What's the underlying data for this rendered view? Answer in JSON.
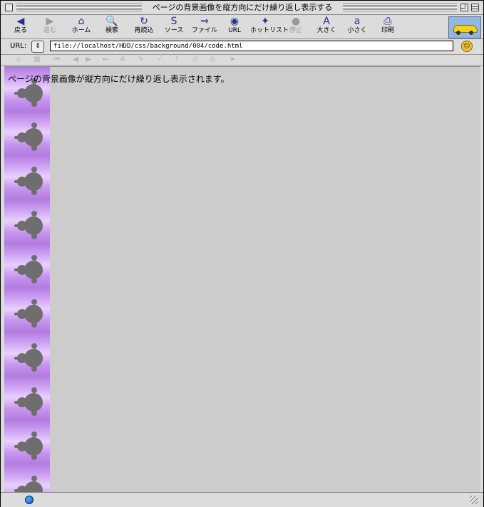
{
  "window": {
    "title": "ページの背景画像を縦方向にだけ繰り返し表示する"
  },
  "toolbar": {
    "buttons": [
      {
        "label": "戻る",
        "icon": "back-arrow-icon",
        "glyph": "◀",
        "enabled": true
      },
      {
        "label": "進む",
        "icon": "forward-arrow-icon",
        "glyph": "▶",
        "enabled": false
      },
      {
        "label": "ホーム",
        "icon": "home-icon",
        "glyph": "⌂",
        "enabled": true
      },
      {
        "label": "検索",
        "icon": "search-icon",
        "glyph": "🔍",
        "enabled": true
      },
      {
        "label": "再読込",
        "icon": "reload-icon",
        "glyph": "↻",
        "enabled": true
      },
      {
        "label": "ソース",
        "icon": "source-icon",
        "glyph": "S",
        "enabled": true
      },
      {
        "label": "ファイル",
        "icon": "file-icon",
        "glyph": "⇒",
        "enabled": true
      },
      {
        "label": "URL",
        "icon": "url-globe-icon",
        "glyph": "◉",
        "enabled": true
      },
      {
        "label": "ホットリスト",
        "icon": "hotlist-icon",
        "glyph": "✦",
        "enabled": true
      },
      {
        "label": "停止",
        "icon": "stop-icon",
        "glyph": "●",
        "enabled": false
      },
      {
        "label": "大きく",
        "icon": "larger-text-icon",
        "glyph": "A",
        "enabled": true
      },
      {
        "label": "小さく",
        "icon": "smaller-text-icon",
        "glyph": "a",
        "enabled": true
      },
      {
        "label": "印刷",
        "icon": "print-icon",
        "glyph": "⎙",
        "enabled": true
      }
    ]
  },
  "url_bar": {
    "label": "URL:",
    "stepper_glyph": "⇕",
    "value": "file://localhost/HDD/css/background/004/code.html",
    "status_glyph": "☺"
  },
  "nav_bar": {
    "icons": [
      {
        "name": "nav-home-icon",
        "glyph": "⌂"
      },
      {
        "name": "nav-grid-icon",
        "glyph": "▦"
      },
      {
        "name": "nav-first-icon",
        "glyph": "⏮"
      },
      {
        "name": "nav-prev-icon",
        "glyph": "◀"
      },
      {
        "name": "nav-next-icon",
        "glyph": "▶"
      },
      {
        "name": "nav-last-icon",
        "glyph": "⏭"
      },
      {
        "name": "nav-font-icon",
        "glyph": "A"
      },
      {
        "name": "nav-edit-icon",
        "glyph": "✎"
      },
      {
        "name": "nav-check-icon",
        "glyph": "✓"
      },
      {
        "name": "nav-help-icon",
        "glyph": "?"
      },
      {
        "name": "nav-globe-icon",
        "glyph": "◎"
      },
      {
        "name": "nav-globe2-icon",
        "glyph": "◎"
      },
      {
        "name": "nav-send-icon",
        "glyph": "➤"
      }
    ]
  },
  "content": {
    "text": "ページの背景画像が縦方向にだけ繰り返し表示されます。",
    "background_color": "#cccccc",
    "tile_color": "#b27ce0"
  }
}
